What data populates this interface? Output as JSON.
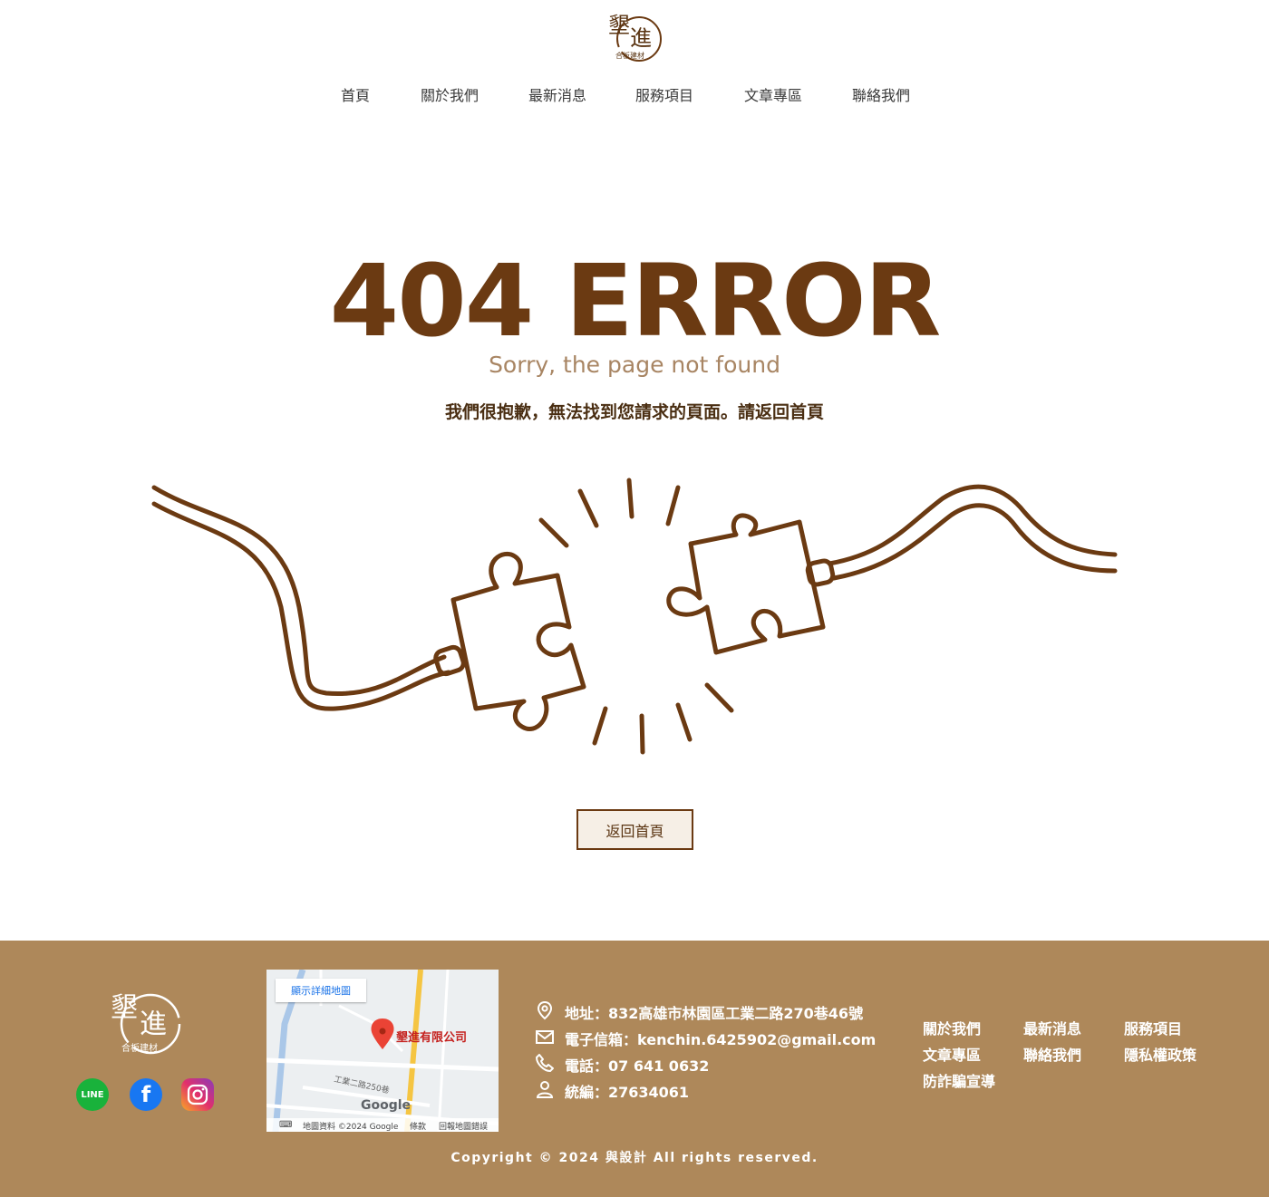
{
  "header": {
    "logo_alt": "墾進 合板建材",
    "nav": [
      "首頁",
      "關於我們",
      "最新消息",
      "服務項目",
      "文章專區",
      "聯絡我們"
    ]
  },
  "error": {
    "title": "404 ERROR",
    "subtitle": "Sorry, the page not found",
    "message": "我們很抱歉，無法找到您請求的頁面。請返回首頁",
    "button_label": "返回首頁"
  },
  "footer": {
    "logo_alt": "墾進 合板建材",
    "social": [
      {
        "name": "line-icon",
        "label": "LINE",
        "color": "#19b23b"
      },
      {
        "name": "facebook-icon",
        "label": "f",
        "color": "#1877f2"
      },
      {
        "name": "instagram-icon",
        "label": "",
        "color": "#e1306c"
      }
    ],
    "map": {
      "button": "顯示詳細地圖",
      "place": "墾進有限公司",
      "road": "工業二路250巷",
      "brand": "Google",
      "bar_data": "地圖資料 ©2024 Google",
      "bar_terms": "條款",
      "bar_report": "回報地圖錯誤"
    },
    "contact": [
      {
        "icon": "location-pin-icon",
        "text": "地址：832高雄市林園區工業二路270巷46號"
      },
      {
        "icon": "mail-icon",
        "text": "電子信箱：kenchin.6425902@gmail.com"
      },
      {
        "icon": "phone-icon",
        "text": "電話：07 641 0632"
      },
      {
        "icon": "person-icon",
        "text": "統編：27634061"
      }
    ],
    "links": [
      "關於我們",
      "最新消息",
      "服務項目",
      "文章專區",
      "聯絡我們",
      "隱私權政策",
      "防詐騙宣導"
    ],
    "copyright": "Copyright © 2024 與設計 All rights reserved."
  },
  "colors": {
    "brand_brown": "#6b3a12",
    "footer_bg": "#ae885a",
    "subtitle": "#a88563"
  }
}
